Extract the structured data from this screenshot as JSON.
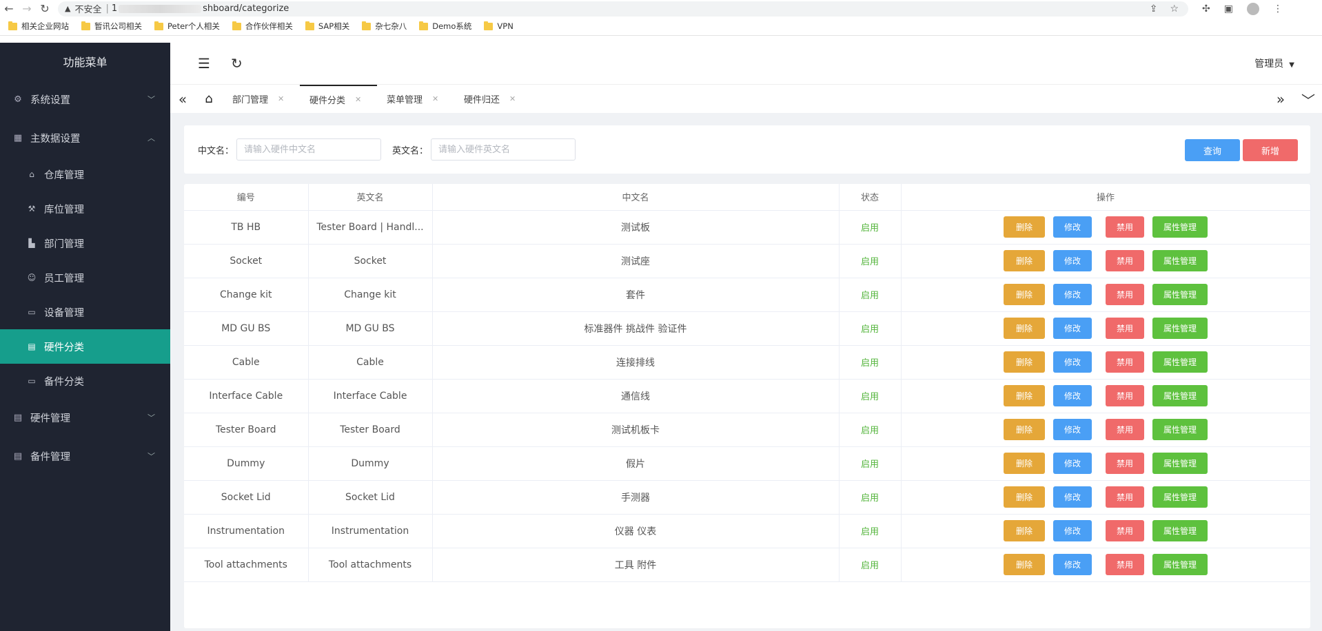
{
  "browser": {
    "insecure_label": "不安全",
    "url_prefix": "1",
    "url_suffix": "shboard/categorize"
  },
  "bookmarks": [
    "相关企业网站",
    "暂讯公司相关",
    "Peter个人相关",
    "合作伙伴相关",
    "SAP相关",
    "杂七杂八",
    "Demo系统",
    "VPN"
  ],
  "sidebar": {
    "title": "功能菜单",
    "groups": [
      {
        "label": "系统设置",
        "icon": "gear-icon"
      },
      {
        "label": "主数据设置",
        "icon": "grid-icon"
      },
      {
        "label": "硬件管理",
        "icon": "box-icon"
      },
      {
        "label": "备件管理",
        "icon": "box-icon"
      }
    ],
    "sub_items": [
      {
        "label": "仓库管理",
        "icon": "home-icon"
      },
      {
        "label": "库位管理",
        "icon": "wrench-icon"
      },
      {
        "label": "部门管理",
        "icon": "building-icon"
      },
      {
        "label": "员工管理",
        "icon": "user-icon"
      },
      {
        "label": "设备管理",
        "icon": "device-icon"
      },
      {
        "label": "硬件分类",
        "icon": "box-icon"
      },
      {
        "label": "备件分类",
        "icon": "device-icon"
      }
    ]
  },
  "header": {
    "user": "管理员"
  },
  "tabs": [
    {
      "label": "部门管理"
    },
    {
      "label": "硬件分类"
    },
    {
      "label": "菜单管理"
    },
    {
      "label": "硬件归还"
    }
  ],
  "filter": {
    "cn_label": "中文名：",
    "cn_placeholder": "请输入硬件中文名",
    "en_label": "英文名：",
    "en_placeholder": "请输入硬件英文名",
    "query": "查询",
    "add": "新增"
  },
  "table": {
    "headers": [
      "编号",
      "英文名",
      "中文名",
      "状态",
      "操作"
    ],
    "actions": {
      "delete": "删除",
      "edit": "修改",
      "disable": "禁用",
      "attr": "属性管理"
    },
    "rows": [
      {
        "code": "TB HB",
        "en": "Tester Board | Handl...",
        "cn": "测试板",
        "status": "启用"
      },
      {
        "code": "Socket",
        "en": "Socket",
        "cn": "测试座",
        "status": "启用"
      },
      {
        "code": "Change kit",
        "en": "Change kit",
        "cn": "套件",
        "status": "启用"
      },
      {
        "code": "MD GU BS",
        "en": "MD GU BS",
        "cn": "标准器件 挑战件 验证件",
        "status": "启用"
      },
      {
        "code": "Cable",
        "en": "Cable",
        "cn": "连接排线",
        "status": "启用"
      },
      {
        "code": "Interface Cable",
        "en": "Interface Cable",
        "cn": "通信线",
        "status": "启用"
      },
      {
        "code": "Tester Board",
        "en": "Tester Board",
        "cn": "测试机板卡",
        "status": "启用"
      },
      {
        "code": "Dummy",
        "en": "Dummy",
        "cn": "假片",
        "status": "启用"
      },
      {
        "code": "Socket Lid",
        "en": "Socket Lid",
        "cn": "手测器",
        "status": "启用"
      },
      {
        "code": "Instrumentation",
        "en": "Instrumentation",
        "cn": "仪器 仪表",
        "status": "启用"
      },
      {
        "code": "Tool attachments",
        "en": "Tool attachments",
        "cn": "工具 附件",
        "status": "启用"
      }
    ]
  }
}
